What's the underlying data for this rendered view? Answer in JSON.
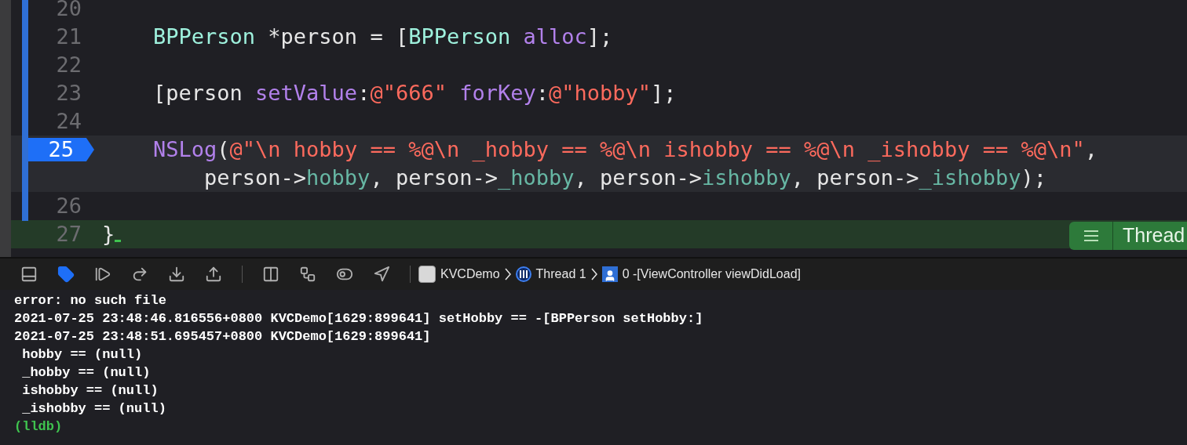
{
  "editor": {
    "lines": [
      {
        "number": "20",
        "current": false
      },
      {
        "number": "21",
        "current": false,
        "visual_lines": [
          {
            "tokens": [
              {
                "text": "    BPPerson",
                "kind": "class"
              },
              {
                "text": " *person = [",
                "kind": "plain"
              },
              {
                "text": "BPPerson",
                "kind": "class"
              },
              {
                "text": " alloc",
                "kind": "method"
              },
              {
                "text": "];",
                "kind": "plain"
              }
            ]
          }
        ]
      },
      {
        "number": "22",
        "current": false
      },
      {
        "number": "23",
        "current": false,
        "visual_lines": [
          {
            "tokens": [
              {
                "text": "    [person ",
                "kind": "plain"
              },
              {
                "text": "setValue",
                "kind": "method"
              },
              {
                "text": ":",
                "kind": "plain"
              },
              {
                "text": "@\"666\"",
                "kind": "string"
              },
              {
                "text": " forKey",
                "kind": "method"
              },
              {
                "text": ":",
                "kind": "plain"
              },
              {
                "text": "@\"hobby\"",
                "kind": "string"
              },
              {
                "text": "];",
                "kind": "plain"
              }
            ]
          }
        ]
      },
      {
        "number": "24",
        "current": false
      },
      {
        "number": "25",
        "current": true,
        "visual_lines": [
          {
            "tokens": [
              {
                "text": "    NSLog",
                "kind": "method"
              },
              {
                "text": "(",
                "kind": "plain"
              },
              {
                "text": "@\"\\n hobby == %@\\n _hobby == %@\\n ishobby == %@\\n _ishobby == %@\\n\"",
                "kind": "string"
              },
              {
                "text": ",",
                "kind": "plain"
              }
            ]
          },
          {
            "tokens": [
              {
                "text": "        person->",
                "kind": "plain"
              },
              {
                "text": "hobby",
                "kind": "ivar"
              },
              {
                "text": ", person->",
                "kind": "plain"
              },
              {
                "text": "_hobby",
                "kind": "ivar"
              },
              {
                "text": ", person->",
                "kind": "plain"
              },
              {
                "text": "ishobby",
                "kind": "ivar"
              },
              {
                "text": ", person->",
                "kind": "plain"
              },
              {
                "text": "_ishobby",
                "kind": "ivar"
              },
              {
                "text": ");",
                "kind": "plain"
              }
            ]
          }
        ]
      },
      {
        "number": "26",
        "current": false
      },
      {
        "number": "27",
        "current": false,
        "visual_lines": [
          {
            "tokens": [
              {
                "text": "}",
                "kind": "plain"
              }
            ]
          }
        ]
      }
    ],
    "thread_badge": {
      "label": "Thread"
    }
  },
  "debug_bar": {
    "breakpoints_active": true,
    "breadcrumbs": [
      {
        "kind": "app",
        "label": "KVCDemo"
      },
      {
        "kind": "thread",
        "label": "Thread 1"
      },
      {
        "kind": "frame",
        "label": "0 -[ViewController viewDidLoad]"
      }
    ]
  },
  "console": {
    "lines": [
      {
        "kind": "output",
        "text": "error: no such file"
      },
      {
        "kind": "output",
        "text": "2021-07-25 23:48:46.816556+0800 KVCDemo[1629:899641] setHobby == -[BPPerson setHobby:]"
      },
      {
        "kind": "output",
        "text": "2021-07-25 23:48:51.695457+0800 KVCDemo[1629:899641]"
      },
      {
        "kind": "output",
        "text": " hobby == (null)"
      },
      {
        "kind": "output",
        "text": " _hobby == (null)"
      },
      {
        "kind": "output",
        "text": " ishobby == (null)"
      },
      {
        "kind": "output",
        "text": " _ishobby == (null)"
      },
      {
        "kind": "prompt",
        "text": "(lldb)"
      }
    ]
  }
}
